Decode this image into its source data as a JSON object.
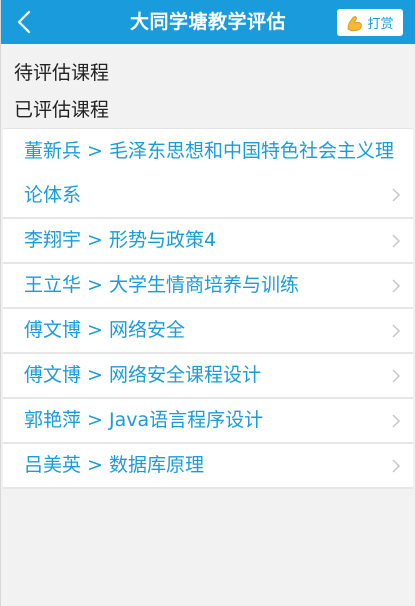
{
  "header": {
    "title": "大同学塘教学评估",
    "reward_label": "打赏"
  },
  "sections": {
    "pending": "待评估课程",
    "evaluated": "已评估课程"
  },
  "courses": [
    {
      "teacher": "董新兵",
      "course": "毛泽东思想和中国特色社会主义理论体系",
      "text": "董新兵 > 毛泽东思想和中国特色社会主义理论体系"
    },
    {
      "teacher": "李翔宇",
      "course": "形势与政策4",
      "text": "李翔宇 > 形势与政策4"
    },
    {
      "teacher": "王立华",
      "course": "大学生情商培养与训练",
      "text": "王立华 > 大学生情商培养与训练"
    },
    {
      "teacher": "傅文博",
      "course": "网络安全",
      "text": "傅文博 > 网络安全"
    },
    {
      "teacher": "傅文博",
      "course": "网络安全课程设计",
      "text": "傅文博 > 网络安全课程设计"
    },
    {
      "teacher": "郭艳萍",
      "course": "Java语言程序设计",
      "text": "郭艳萍 > Java语言程序设计"
    },
    {
      "teacher": "吕美英",
      "course": "数据库原理",
      "text": "吕美英 > 数据库原理"
    }
  ],
  "icons": {
    "back": "chevron-left-icon",
    "reward": "flexed-biceps-icon",
    "row_arrow": "chevron-right-icon"
  },
  "colors": {
    "header_bg": "#1a9bdc",
    "accent_text": "#1a9bdc",
    "page_bg": "#f2f2f2"
  }
}
